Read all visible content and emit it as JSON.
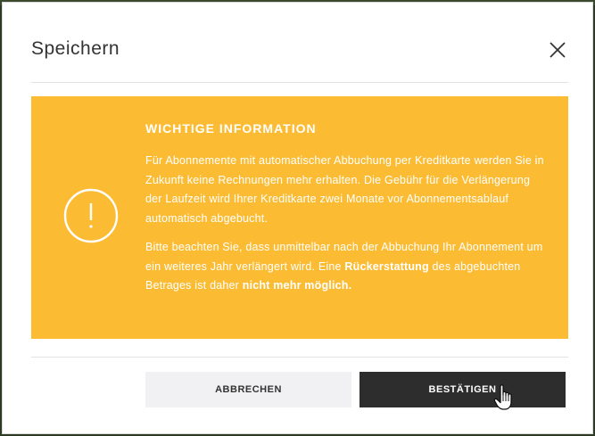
{
  "dialog": {
    "title": "Speichern",
    "close_icon": "close-icon"
  },
  "alert": {
    "icon": "exclamation-circle-icon",
    "background_color": "#fbbc33",
    "heading": "WICHTIGE INFORMATION",
    "paragraph1": "Für Abonnemente mit automatischer Abbuchung per Kreditkarte werden Sie in Zukunft keine Rechnungen mehr erhalten. Die Gebühr für die Verlängerung der Laufzeit wird Ihrer Kreditkarte zwei Monate vor Abonnementsablauf automatisch abgebucht.",
    "paragraph2_part1": "Bitte beachten Sie, dass unmittelbar nach der Abbuchung Ihr Abonnement um ein weiteres Jahr verlängert wird. Eine ",
    "paragraph2_bold1": "Rückerstattung",
    "paragraph2_part2": " des abgebuchten Betrages ist daher ",
    "paragraph2_bold2": "nicht mehr möglich."
  },
  "buttons": {
    "cancel_label": "ABBRECHEN",
    "confirm_label": "BESTÄTIGEN"
  },
  "cursor": {
    "icon": "hand-pointer-icon"
  }
}
